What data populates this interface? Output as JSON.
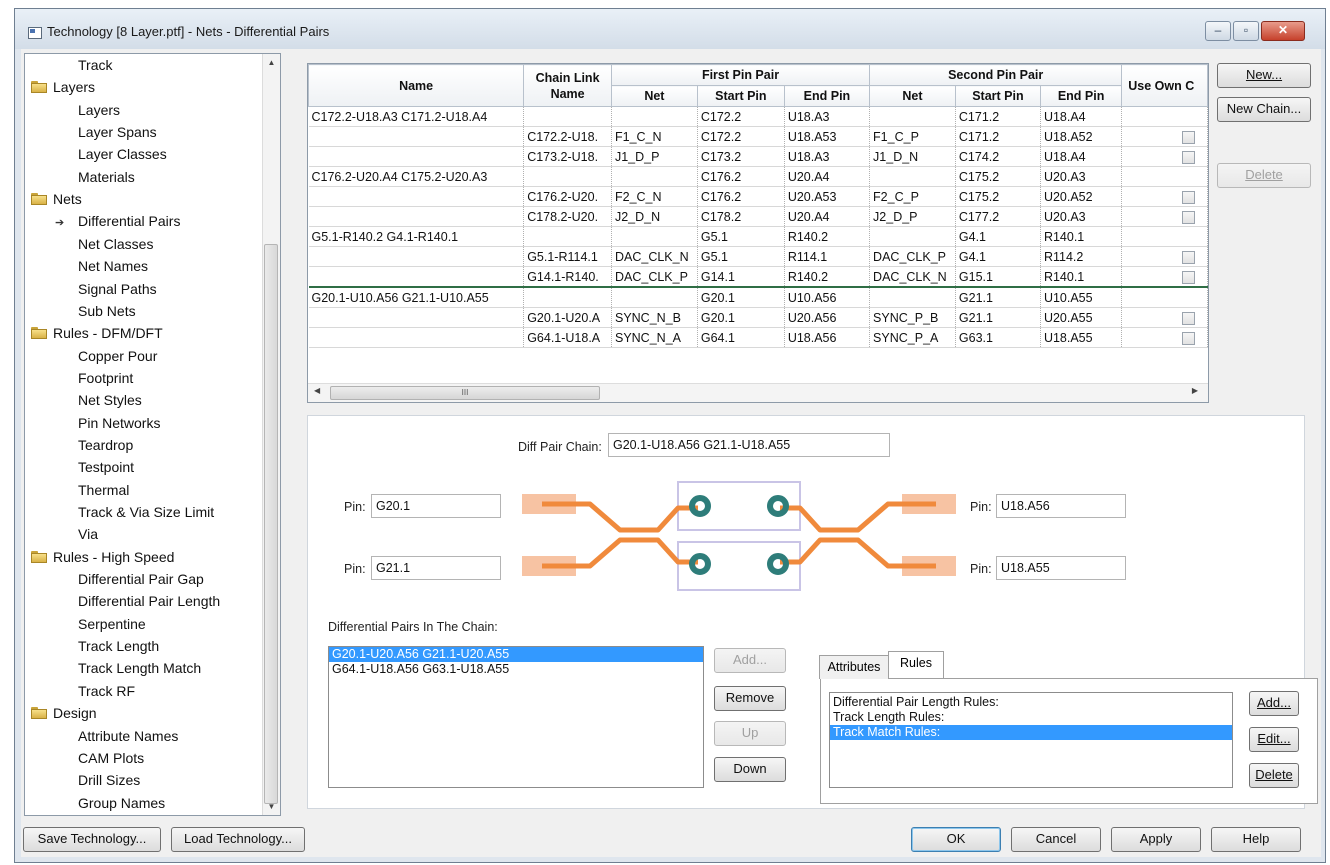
{
  "window": {
    "title": "Technology [8 Layer.ptf]  - Nets - Differential Pairs",
    "minimize_glyph": "‒",
    "restore_glyph": "▫",
    "close_glyph": "✕"
  },
  "tree": {
    "items": [
      {
        "label": "Track",
        "level": 1,
        "icon": "none"
      },
      {
        "label": "Layers",
        "level": 0,
        "icon": "folder-icon"
      },
      {
        "label": "Layers",
        "level": 1,
        "icon": "none"
      },
      {
        "label": "Layer Spans",
        "level": 1,
        "icon": "none"
      },
      {
        "label": "Layer Classes",
        "level": 1,
        "icon": "none"
      },
      {
        "label": "Materials",
        "level": 1,
        "icon": "none"
      },
      {
        "label": "Nets",
        "level": 0,
        "icon": "folder-icon"
      },
      {
        "label": "Differential Pairs",
        "level": 1,
        "icon": "selected-arrow-icon"
      },
      {
        "label": "Net Classes",
        "level": 1,
        "icon": "none"
      },
      {
        "label": "Net Names",
        "level": 1,
        "icon": "none"
      },
      {
        "label": "Signal Paths",
        "level": 1,
        "icon": "none"
      },
      {
        "label": "Sub Nets",
        "level": 1,
        "icon": "none"
      },
      {
        "label": "Rules - DFM/DFT",
        "level": 0,
        "icon": "folder-icon"
      },
      {
        "label": "Copper Pour",
        "level": 1,
        "icon": "none"
      },
      {
        "label": "Footprint",
        "level": 1,
        "icon": "none"
      },
      {
        "label": "Net Styles",
        "level": 1,
        "icon": "none"
      },
      {
        "label": "Pin Networks",
        "level": 1,
        "icon": "none"
      },
      {
        "label": "Teardrop",
        "level": 1,
        "icon": "none"
      },
      {
        "label": "Testpoint",
        "level": 1,
        "icon": "none"
      },
      {
        "label": "Thermal",
        "level": 1,
        "icon": "none"
      },
      {
        "label": "Track & Via Size Limit",
        "level": 1,
        "icon": "none"
      },
      {
        "label": "Via",
        "level": 1,
        "icon": "none"
      },
      {
        "label": "Rules - High Speed",
        "level": 0,
        "icon": "folder-icon"
      },
      {
        "label": "Differential Pair Gap",
        "level": 1,
        "icon": "none"
      },
      {
        "label": "Differential Pair Length",
        "level": 1,
        "icon": "none"
      },
      {
        "label": "Serpentine",
        "level": 1,
        "icon": "none"
      },
      {
        "label": "Track Length",
        "level": 1,
        "icon": "none"
      },
      {
        "label": "Track Length Match",
        "level": 1,
        "icon": "none"
      },
      {
        "label": "Track RF",
        "level": 1,
        "icon": "none"
      },
      {
        "label": "Design",
        "level": 0,
        "icon": "folder-icon"
      },
      {
        "label": "Attribute Names",
        "level": 1,
        "icon": "none"
      },
      {
        "label": "CAM Plots",
        "level": 1,
        "icon": "none"
      },
      {
        "label": "Drill Sizes",
        "level": 1,
        "icon": "none"
      },
      {
        "label": "Group Names",
        "level": 1,
        "icon": "none"
      }
    ]
  },
  "grid": {
    "headers": {
      "name": "Name",
      "chain_link": "Chain Link Name",
      "first_pin_pair": "First Pin Pair",
      "second_pin_pair": "Second Pin Pair",
      "use_own": "Use Own C",
      "net": "Net",
      "start_pin": "Start Pin",
      "end_pin": "End Pin",
      "net2": "Net",
      "start_pin2": "Start Pin",
      "end_pin2": "End Pin"
    },
    "rows": [
      {
        "kind": "chain",
        "name": "C172.2-U18.A3 C171.2-U18.A4",
        "link": "",
        "net1": "",
        "start1": "C172.2",
        "end1": "U18.A3",
        "net2": "",
        "start2": "C171.2",
        "end2": "U18.A4",
        "check": false
      },
      {
        "kind": "link",
        "name": "",
        "link": "C172.2-U18.",
        "net1": "F1_C_N",
        "start1": "C172.2",
        "end1": "U18.A53",
        "net2": "F1_C_P",
        "start2": "C171.2",
        "end2": "U18.A52",
        "check": true
      },
      {
        "kind": "link",
        "name": "",
        "link": "C173.2-U18.",
        "net1": "J1_D_P",
        "start1": "C173.2",
        "end1": "U18.A3",
        "net2": "J1_D_N",
        "start2": "C174.2",
        "end2": "U18.A4",
        "check": true
      },
      {
        "kind": "chain",
        "name": "C176.2-U20.A4 C175.2-U20.A3",
        "link": "",
        "net1": "",
        "start1": "C176.2",
        "end1": "U20.A4",
        "net2": "",
        "start2": "C175.2",
        "end2": "U20.A3",
        "check": false
      },
      {
        "kind": "link",
        "name": "",
        "link": "C176.2-U20.",
        "net1": "F2_C_N",
        "start1": "C176.2",
        "end1": "U20.A53",
        "net2": "F2_C_P",
        "start2": "C175.2",
        "end2": "U20.A52",
        "check": true
      },
      {
        "kind": "link",
        "name": "",
        "link": "C178.2-U20.",
        "net1": "J2_D_N",
        "start1": "C178.2",
        "end1": "U20.A4",
        "net2": "J2_D_P",
        "start2": "C177.2",
        "end2": "U20.A3",
        "check": true
      },
      {
        "kind": "chain",
        "name": "G5.1-R140.2 G4.1-R140.1",
        "link": "",
        "net1": "",
        "start1": "G5.1",
        "end1": "R140.2",
        "net2": "",
        "start2": "G4.1",
        "end2": "R140.1",
        "check": false
      },
      {
        "kind": "link",
        "name": "",
        "link": "G5.1-R114.1",
        "net1": "DAC_CLK_N",
        "start1": "G5.1",
        "end1": "R114.1",
        "net2": "DAC_CLK_P",
        "start2": "G4.1",
        "end2": "R114.2",
        "check": true
      },
      {
        "kind": "link",
        "name": "",
        "link": "G14.1-R140.",
        "net1": "DAC_CLK_P",
        "start1": "G14.1",
        "end1": "R140.2",
        "net2": "DAC_CLK_N",
        "start2": "G15.1",
        "end2": "R140.1",
        "check": true
      },
      {
        "kind": "chain",
        "name": "G20.1-U10.A56 G21.1-U10.A55",
        "link": "",
        "net1": "",
        "start1": "G20.1",
        "end1": "U10.A56",
        "net2": "",
        "start2": "G21.1",
        "end2": "U10.A55",
        "check": false
      },
      {
        "kind": "link",
        "name": "",
        "link": "G20.1-U20.A",
        "net1": "SYNC_N_B",
        "start1": "G20.1",
        "end1": "U20.A56",
        "net2": "SYNC_P_B",
        "start2": "G21.1",
        "end2": "U20.A55",
        "check": true
      },
      {
        "kind": "link",
        "name": "",
        "link": "G64.1-U18.A",
        "net1": "SYNC_N_A",
        "start1": "G64.1",
        "end1": "U18.A56",
        "net2": "SYNC_P_A",
        "start2": "G63.1",
        "end2": "U18.A55",
        "check": true
      }
    ],
    "scroll_grip": "III"
  },
  "side_buttons": {
    "new": "New...",
    "new_chain": "New Chain...",
    "delete": "Delete"
  },
  "detail": {
    "diff_pair_chain_label": "Diff Pair Chain:",
    "diff_pair_chain_value": "G20.1-U18.A56 G21.1-U18.A55",
    "pin_label": "Pin:",
    "pin_left_top": "G20.1",
    "pin_left_bottom": "G21.1",
    "pin_right_top": "U18.A56",
    "pin_right_bottom": "U18.A55",
    "pairs_in_chain_label": "Differential Pairs In The Chain:",
    "pairs_in_chain": [
      {
        "label": "G20.1-U20.A56 G21.1-U20.A55",
        "selected": true
      },
      {
        "label": "G64.1-U18.A56 G63.1-U18.A55",
        "selected": false
      }
    ],
    "chain_buttons": {
      "add": "Add...",
      "remove": "Remove",
      "up": "Up",
      "down": "Down"
    },
    "tabs": [
      {
        "label": "Attributes",
        "active": false
      },
      {
        "label": "Rules",
        "active": true
      }
    ],
    "rules_list": [
      {
        "label": "Differential Pair Length Rules:",
        "selected": false
      },
      {
        "label": "Track Length Rules:",
        "selected": false
      },
      {
        "label": "Track Match Rules:",
        "selected": true
      }
    ],
    "rule_buttons": {
      "add": "Add...",
      "edit": "Edit...",
      "delete": "Delete"
    },
    "colors": {
      "trace": "#f08a3c",
      "pad": "#f7c3a3",
      "via": "#2e7d7a",
      "component_outline": "#c9c4e6"
    }
  },
  "footer": {
    "save": "Save Technology...",
    "load": "Load Technology...",
    "ok": "OK",
    "cancel": "Cancel",
    "apply": "Apply",
    "help": "Help"
  }
}
